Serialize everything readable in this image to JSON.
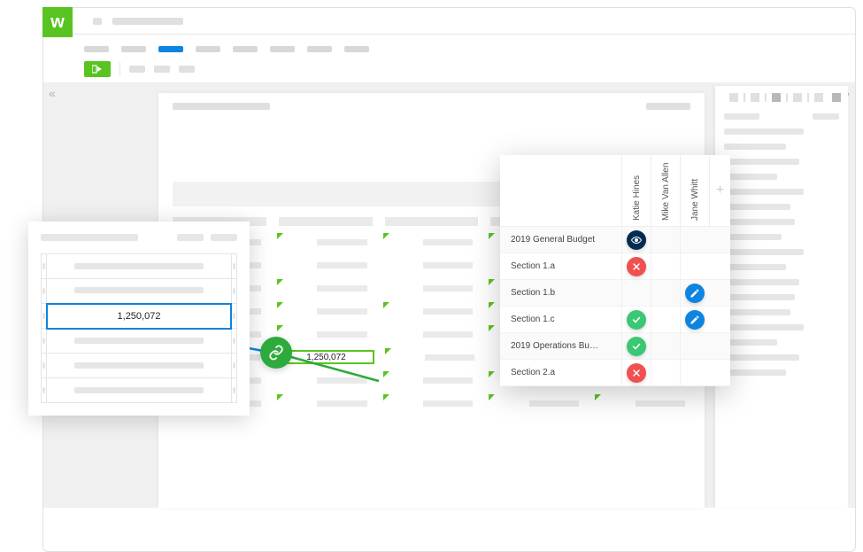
{
  "app": {
    "logo_letter": "w"
  },
  "source_cell": {
    "value": "1,250,072"
  },
  "linked_cell": {
    "value": "1,250,072"
  },
  "permissions": {
    "users": [
      "Katie Hines",
      "Mike Van Allen",
      "Jane Whitt"
    ],
    "rows": [
      {
        "label": "2019 General Budget",
        "cells": [
          "eye",
          "",
          ""
        ]
      },
      {
        "label": "Section 1.a",
        "cells": [
          "no",
          "",
          ""
        ]
      },
      {
        "label": "Section 1.b",
        "cells": [
          "",
          "",
          "edit"
        ]
      },
      {
        "label": "Section 1.c",
        "cells": [
          "yes",
          "",
          "edit"
        ]
      },
      {
        "label": "2019 Operations Bu…",
        "cells": [
          "yes",
          "",
          ""
        ]
      },
      {
        "label": "Section 2.a",
        "cells": [
          "no",
          "",
          ""
        ]
      }
    ]
  },
  "colors": {
    "brand_green": "#59C421",
    "link_green": "#2DAA3C",
    "select_blue": "#0D84E0",
    "deny_red": "#F15050",
    "allow_green": "#3CC774",
    "view_navy": "#022B53"
  }
}
